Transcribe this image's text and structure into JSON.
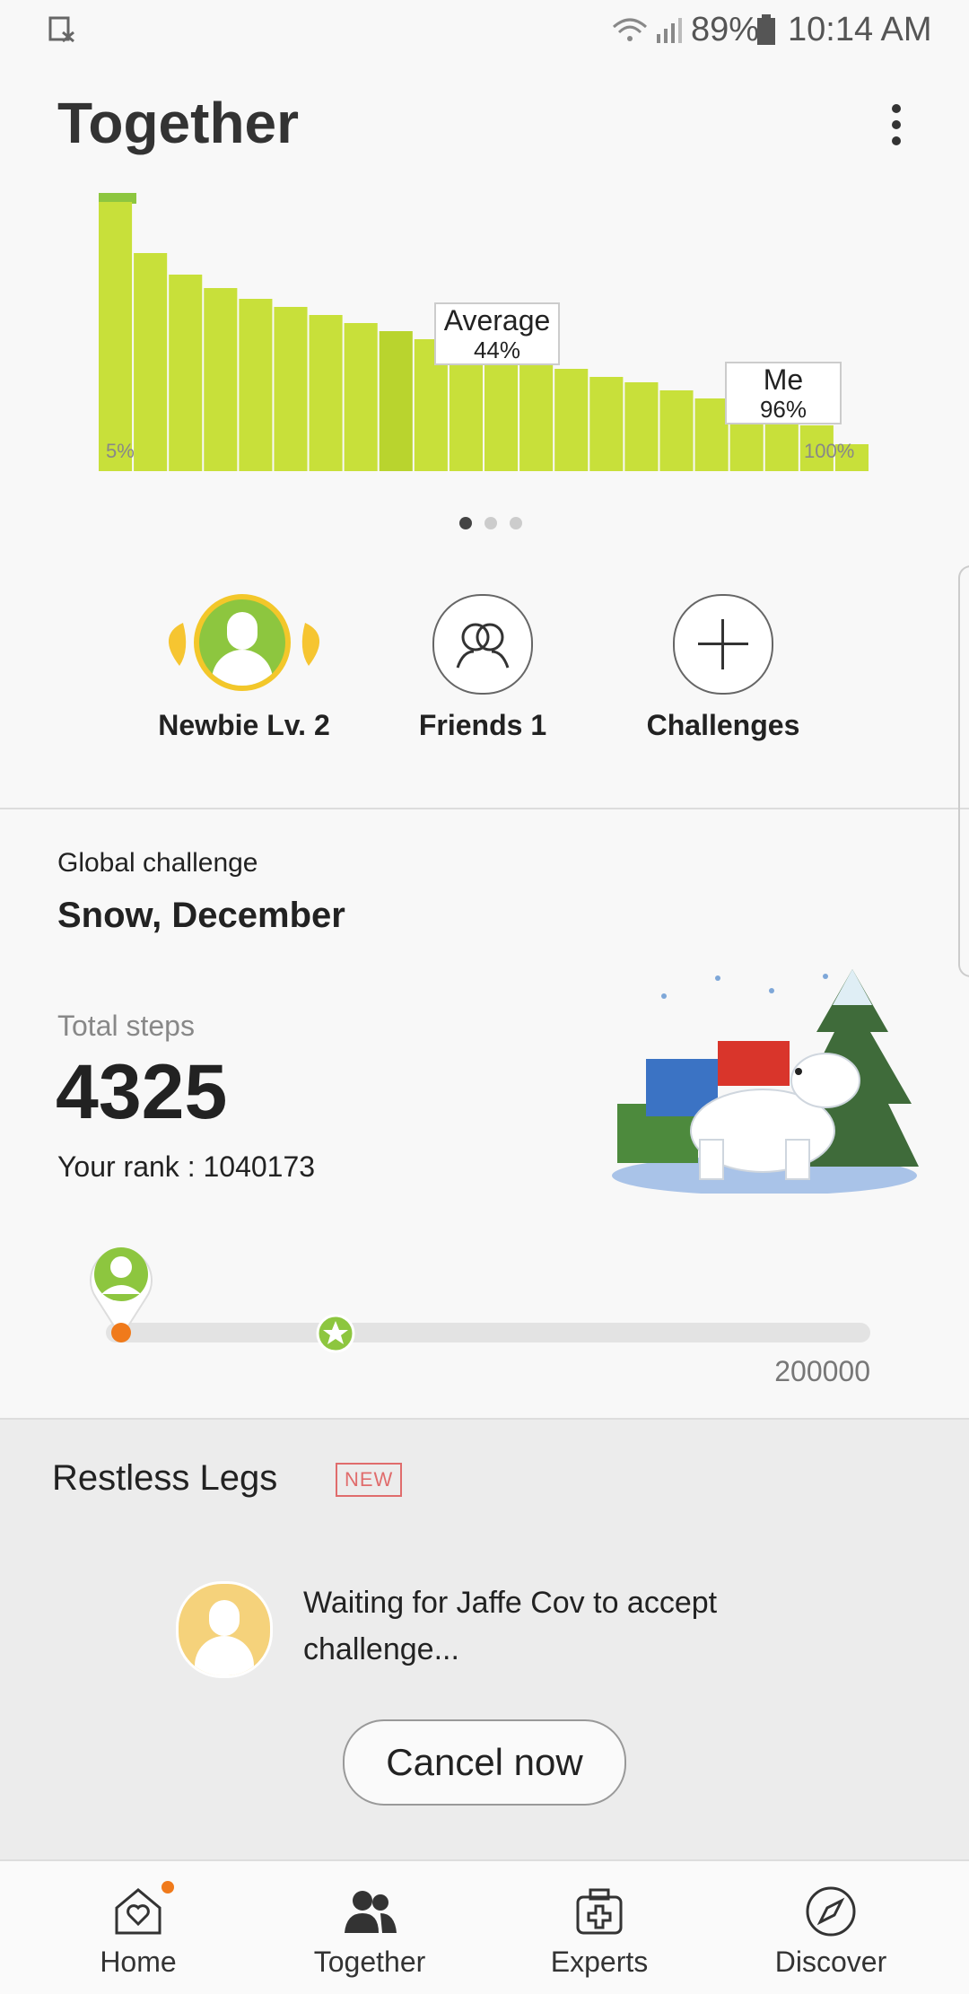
{
  "status_bar": {
    "battery": "89%",
    "time": "10:14 AM"
  },
  "header": {
    "title": "Together"
  },
  "chart_data": {
    "type": "area",
    "x_labels": [
      "5%",
      "100%"
    ],
    "values": [
      100,
      81,
      73,
      68,
      64,
      61,
      58,
      55,
      52,
      49,
      46,
      43,
      40,
      38,
      35,
      33,
      30,
      27,
      24,
      21,
      17,
      10
    ],
    "highlight_index": 8,
    "callouts": [
      {
        "title": "Average",
        "value": "44%"
      },
      {
        "title": "Me",
        "value": "96%"
      }
    ]
  },
  "pager": {
    "count": 3,
    "active": 0
  },
  "quick_actions": [
    {
      "label": "Newbie Lv. 2",
      "icon": "avatar-icon"
    },
    {
      "label": "Friends 1",
      "icon": "friends-icon"
    },
    {
      "label": "Challenges",
      "icon": "plus-icon"
    }
  ],
  "global_challenge": {
    "section_label": "Global challenge",
    "name": "Snow, December",
    "steps_label": "Total steps",
    "steps": "4325",
    "rank": "Your rank : 1040173",
    "goal": "200000",
    "progress_fraction": 0.02,
    "milestone_fraction": 0.3
  },
  "restless_legs": {
    "title": "Restless Legs",
    "badge": "NEW",
    "message": "Waiting for Jaffe Cov to accept challenge...",
    "cancel_label": "Cancel now"
  },
  "bottom_nav": [
    {
      "label": "Home",
      "icon": "home-heart-icon"
    },
    {
      "label": "Together",
      "icon": "people-icon"
    },
    {
      "label": "Experts",
      "icon": "medical-bag-icon"
    },
    {
      "label": "Discover",
      "icon": "compass-icon"
    }
  ],
  "colors": {
    "accent_green": "#8dc63f",
    "chart_fill": "#c8e03a",
    "orange": "#f07a1b",
    "badge_red": "#e06c6c"
  }
}
